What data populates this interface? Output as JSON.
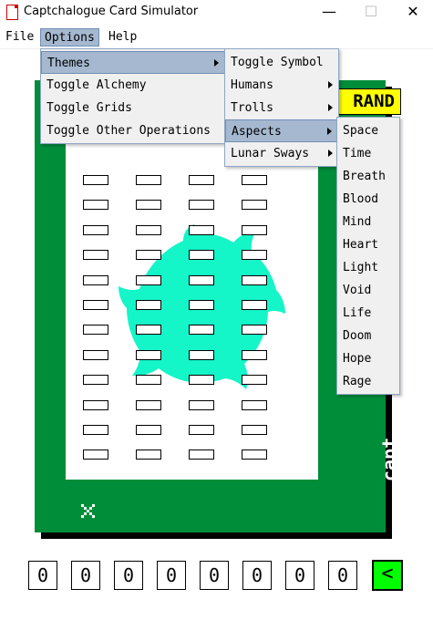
{
  "window": {
    "title": "Captchalogue Card Simulator",
    "minimize_glyph": "—",
    "maximize_glyph": "☐",
    "close_glyph": "✕"
  },
  "menubar": {
    "file": "File",
    "options": "Options",
    "help": "Help"
  },
  "options_menu": {
    "items": [
      {
        "label": "Themes",
        "has_submenu": true,
        "highlighted": true
      },
      {
        "label": "Toggle Alchemy"
      },
      {
        "label": "Toggle Grids"
      },
      {
        "label": "Toggle Other Operations"
      }
    ]
  },
  "themes_menu": {
    "items": [
      {
        "label": "Toggle Symbol"
      },
      {
        "label": "Humans",
        "has_submenu": true
      },
      {
        "label": "Trolls",
        "has_submenu": true
      },
      {
        "label": "Aspects",
        "has_submenu": true,
        "highlighted": true
      },
      {
        "label": "Lunar Sways",
        "has_submenu": true
      }
    ]
  },
  "aspects_menu": {
    "items": [
      {
        "label": "Space"
      },
      {
        "label": "Time"
      },
      {
        "label": "Breath"
      },
      {
        "label": "Blood"
      },
      {
        "label": "Mind"
      },
      {
        "label": "Heart"
      },
      {
        "label": "Light"
      },
      {
        "label": "Void"
      },
      {
        "label": "Life"
      },
      {
        "label": "Doom"
      },
      {
        "label": "Hope"
      },
      {
        "label": "Rage"
      }
    ]
  },
  "card": {
    "brand_label": "RAND",
    "vertical_code": "capt",
    "grid": {
      "rows": 12,
      "columns": 4
    },
    "colors": {
      "card": "#008d3a",
      "symbol": "#14f5c8",
      "brand_bg": "#ffff00"
    },
    "symbol_icon": "spiral-aspect-symbol",
    "corner_icon": "pixel-x-mark"
  },
  "code_digits": [
    "0",
    "0",
    "0",
    "0",
    "0",
    "0",
    "0",
    "0"
  ],
  "back_button_label": "<",
  "back_button_color": "#00ff00"
}
